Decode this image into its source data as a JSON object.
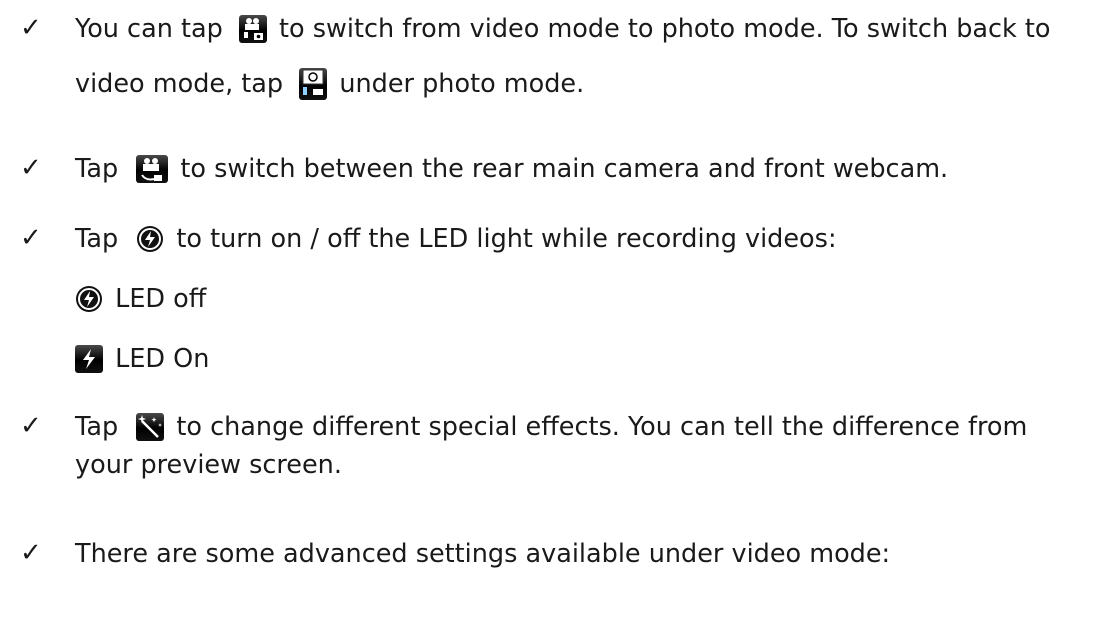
{
  "bullet_glyph": "✓",
  "items": [
    {
      "part1": "You can tap",
      "icon1": "video-to-photo-icon",
      "part2": " to switch from video mode to photo mode. To switch back to",
      "part3": "video mode, tap",
      "icon2": "photo-to-video-icon",
      "part4": " under photo mode."
    },
    {
      "part1": "Tap",
      "icon1": "switch-camera-icon",
      "part2": " to switch between the rear main camera and front webcam."
    },
    {
      "part1": "Tap",
      "icon1": "flash-off-icon",
      "part2": " to turn on / off the LED light while recording videos:",
      "sub": [
        {
          "icon": "flash-off-icon",
          "label": "LED off"
        },
        {
          "icon": "flash-on-icon",
          "label": "LED On"
        }
      ]
    },
    {
      "part1": "Tap",
      "icon1": "magic-wand-icon",
      "part2": " to change different special effects. You can tell the difference from",
      "part3": "your preview screen."
    },
    {
      "part1": "There are some advanced settings available under video mode:"
    }
  ]
}
